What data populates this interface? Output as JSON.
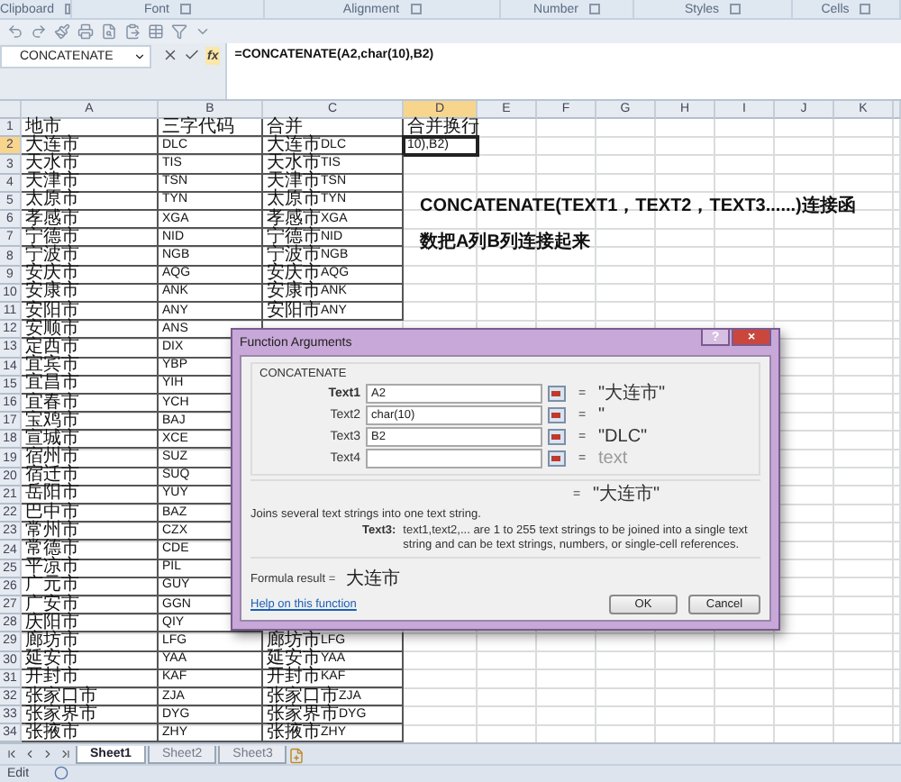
{
  "ribbon_groups": [
    {
      "label": "Clipboard"
    },
    {
      "label": "Font"
    },
    {
      "label": "Alignment"
    },
    {
      "label": "Number"
    },
    {
      "label": "Styles"
    },
    {
      "label": "Cells"
    }
  ],
  "name_box": "CONCATENATE",
  "formula_bar": {
    "fx": "fx",
    "formula": "=CONCATENATE(A2,char(10),B2)"
  },
  "columns": [
    {
      "label": "A",
      "selected": false
    },
    {
      "label": "B",
      "selected": false
    },
    {
      "label": "C",
      "selected": false
    },
    {
      "label": "D",
      "selected": true
    },
    {
      "label": "E",
      "selected": false
    },
    {
      "label": "F",
      "selected": false
    },
    {
      "label": "G",
      "selected": false
    },
    {
      "label": "H",
      "selected": false
    },
    {
      "label": "I",
      "selected": false
    },
    {
      "label": "J",
      "selected": false
    },
    {
      "label": "K",
      "selected": false
    }
  ],
  "rows": [
    {
      "number": "1",
      "selected": false,
      "a": "地市",
      "b": "三字代码",
      "c": "合并",
      "d": "合并换行"
    },
    {
      "number": "2",
      "selected": true,
      "a": "大连市",
      "b": "DLC",
      "c": "大连市DLC",
      "d": "10),B2)"
    },
    {
      "number": "3",
      "selected": false,
      "a": "天水市",
      "b": "TIS",
      "c": "天水市TIS"
    },
    {
      "number": "4",
      "selected": false,
      "a": "天津市",
      "b": "TSN",
      "c": "天津市TSN"
    },
    {
      "number": "5",
      "selected": false,
      "a": "太原市",
      "b": "TYN",
      "c": "太原市TYN"
    },
    {
      "number": "6",
      "selected": false,
      "a": "孝感市",
      "b": "XGA",
      "c": "孝感市XGA"
    },
    {
      "number": "7",
      "selected": false,
      "a": "宁德市",
      "b": "NID",
      "c": "宁德市NID"
    },
    {
      "number": "8",
      "selected": false,
      "a": "宁波市",
      "b": "NGB",
      "c": "宁波市NGB"
    },
    {
      "number": "9",
      "selected": false,
      "a": "安庆市",
      "b": "AQG",
      "c": "安庆市AQG"
    },
    {
      "number": "10",
      "selected": false,
      "a": "安康市",
      "b": "ANK",
      "c": "安康市ANK"
    },
    {
      "number": "11",
      "selected": false,
      "a": "安阳市",
      "b": "ANY",
      "c": "安阳市ANY"
    },
    {
      "number": "12",
      "selected": false,
      "a": "安顺市",
      "b": "ANS"
    },
    {
      "number": "13",
      "selected": false,
      "a": "定西市",
      "b": "DIX"
    },
    {
      "number": "14",
      "selected": false,
      "a": "宜宾市",
      "b": "YBP"
    },
    {
      "number": "15",
      "selected": false,
      "a": "宜昌市",
      "b": "YIH"
    },
    {
      "number": "16",
      "selected": false,
      "a": "宜春市",
      "b": "YCH"
    },
    {
      "number": "17",
      "selected": false,
      "a": "宝鸡市",
      "b": "BAJ"
    },
    {
      "number": "18",
      "selected": false,
      "a": "宣城市",
      "b": "XCE"
    },
    {
      "number": "19",
      "selected": false,
      "a": "宿州市",
      "b": "SUZ"
    },
    {
      "number": "20",
      "selected": false,
      "a": "宿迁市",
      "b": "SUQ"
    },
    {
      "number": "21",
      "selected": false,
      "a": "岳阳市",
      "b": "YUY"
    },
    {
      "number": "22",
      "selected": false,
      "a": "巴中市",
      "b": "BAZ"
    },
    {
      "number": "23",
      "selected": false,
      "a": "常州市",
      "b": "CZX"
    },
    {
      "number": "24",
      "selected": false,
      "a": "常德市",
      "b": "CDE"
    },
    {
      "number": "25",
      "selected": false,
      "a": "平凉市",
      "b": "PIL"
    },
    {
      "number": "26",
      "selected": false,
      "a": "广元市",
      "b": "GUY"
    },
    {
      "number": "27",
      "selected": false,
      "a": "广安市",
      "b": "GGN"
    },
    {
      "number": "28",
      "selected": false,
      "a": "庆阳市",
      "b": "QIY"
    },
    {
      "number": "29",
      "selected": false,
      "a": "廊坊市",
      "b": "LFG",
      "c": "廊坊市LFG"
    },
    {
      "number": "30",
      "selected": false,
      "a": "延安市",
      "b": "YAA",
      "c": "延安市YAA"
    },
    {
      "number": "31",
      "selected": false,
      "a": "开封市",
      "b": "KAF",
      "c": "开封市KAF"
    },
    {
      "number": "32",
      "selected": false,
      "a": "张家口市",
      "b": "ZJA",
      "c": "张家口市ZJA"
    },
    {
      "number": "33",
      "selected": false,
      "a": "张家界市",
      "b": "DYG",
      "c": "张家界市DYG"
    },
    {
      "number": "34",
      "selected": false,
      "a": "张掖市",
      "b": "ZHY",
      "c": "张掖市ZHY"
    }
  ],
  "note_lines": [
    "CONCATENATE(TEXT1，TEXT2，TEXT3......)连接函",
    "数把A列B列连接起来"
  ],
  "dialog": {
    "title": "Function Arguments",
    "help": "?",
    "close": "×",
    "function": "CONCATENATE",
    "arguments": [
      {
        "label": "Text1",
        "required": true,
        "value": "A2",
        "equals": "=",
        "result": "\"大连市\"",
        "placeholder_result": false
      },
      {
        "label": "Text2",
        "required": false,
        "value": "char(10)",
        "equals": "=",
        "result": "\"",
        "placeholder_result": false
      },
      {
        "label": "Text3",
        "required": false,
        "value": "B2",
        "equals": "=",
        "result": "\"DLC\"",
        "placeholder_result": false
      },
      {
        "label": "Text4",
        "required": false,
        "equals": "=",
        "result": "text",
        "placeholder_result": true
      }
    ],
    "total_equals": "=",
    "total": "\"大连市\"",
    "description": "Joins several text strings into one text string.",
    "arg_help_label": "Text3:",
    "arg_help": "text1,text2,... are 1 to 255 text strings to be joined into a single text string and can be text strings, numbers, or single-cell references.",
    "formula_result_label": "Formula result =",
    "formula_result": "大连市",
    "help_link": "Help on this function",
    "buttons": [
      "OK",
      "Cancel"
    ]
  },
  "sheet_tabs": [
    {
      "label": "Sheet1",
      "selected": true
    },
    {
      "label": "Sheet2",
      "selected": false
    },
    {
      "label": "Sheet3",
      "selected": false
    }
  ],
  "status": "Edit"
}
